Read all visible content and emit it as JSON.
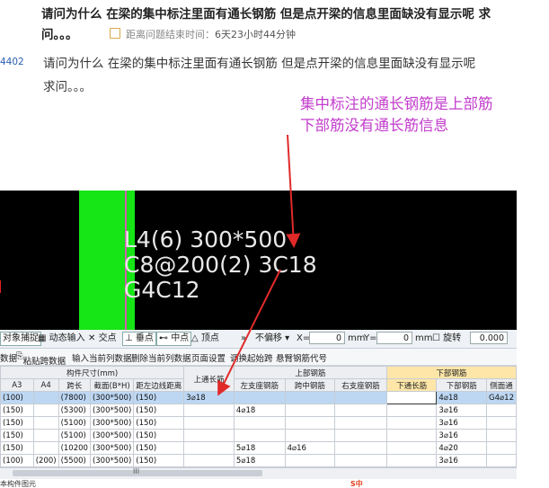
{
  "question": {
    "title_line1": "请问为什么 在梁的集中标注里面有通长钢筋 但是点开梁的信息里面缺没有显示呢 求",
    "title_line2": "问。。。",
    "countdown_label": "距离问题结束时间：",
    "countdown_value": "6天23小时44分钟",
    "id_fragment": "4402",
    "body_line1": "请问为什么 在梁的集中标注里面有通长钢筋 但是点开梁的信息里面缺没有显示呢",
    "body_line2": "求问。。。"
  },
  "annotation": {
    "line1": "集中标注的通长钢筋是上部筋",
    "line2": "下部筋没有通长筋信息",
    "color": "#c23ccc"
  },
  "cad": {
    "line1": "L4(6) 300*500",
    "line2": "C8@200(2) 3C18",
    "line3": "G4C12"
  },
  "toolbar": {
    "snap": "对象捕捉",
    "dynamic_input": "动态输入",
    "intersection": "交点",
    "perpendicular": "垂点",
    "midpoint": "中点",
    "vertex": "顶点",
    "no_offset": "不偏移",
    "x_label": "X=",
    "x_value": "0",
    "mm1": "mm",
    "y_label": "Y=",
    "y_value": "0",
    "mm2": "mm",
    "rotate": "旋转",
    "rotate_value": "0.000"
  },
  "actions": {
    "a0": "数据",
    "a1": "粘贴跨数据",
    "a2": "输入当前列数据",
    "a3": "删除当前列数据",
    "a4": "页面设置",
    "a5": "调换起始跨",
    "a6": "悬臂钢筋代号"
  },
  "grid": {
    "group_size": "构件尺寸(mm)",
    "col_top_through": "上通长筋",
    "group_top": "上部钢筋",
    "group_bottom": "下部钢筋",
    "h_a3": "A3",
    "h_a4": "A4",
    "h_span": "跨长",
    "h_section": "截面(B*H)",
    "h_offset": "距左边线距离",
    "h_left_support": "左支座钢筋",
    "h_mid_span": "跨中钢筋",
    "h_right_support": "右支座钢筋",
    "h_bottom_through": "下通长筋",
    "h_bottom_rebar": "下部钢筋",
    "h_side": "侧面通",
    "rows": [
      {
        "a3": "(100)",
        "a4": "",
        "span": "(7800)",
        "section": "(300*500)",
        "offset": "(150)",
        "top_through": "3⌀18",
        "left": "",
        "mid": "",
        "right": "",
        "bot_through": "",
        "bot": "4⌀18",
        "side": "G4⌀12"
      },
      {
        "a3": "(150)",
        "a4": "",
        "span": "(5300)",
        "section": "(300*500)",
        "offset": "(150)",
        "top_through": "",
        "left": "4⌀18",
        "mid": "",
        "right": "",
        "bot_through": "",
        "bot": "3⌀16",
        "side": ""
      },
      {
        "a3": "(150)",
        "a4": "",
        "span": "(5100)",
        "section": "(300*500)",
        "offset": "(150)",
        "top_through": "",
        "left": "",
        "mid": "",
        "right": "",
        "bot_through": "",
        "bot": "3⌀16",
        "side": ""
      },
      {
        "a3": "(150)",
        "a4": "",
        "span": "(5100)",
        "section": "(300*500)",
        "offset": "(150)",
        "top_through": "",
        "left": "",
        "mid": "",
        "right": "",
        "bot_through": "",
        "bot": "3⌀16",
        "side": ""
      },
      {
        "a3": "(150)",
        "a4": "",
        "span": "(10200",
        "section": "(300*500)",
        "offset": "(150)",
        "top_through": "",
        "left": "5⌀18",
        "mid": "4⌀16",
        "right": "",
        "bot_through": "",
        "bot": "4⌀20",
        "side": ""
      },
      {
        "a3": "(100)",
        "a4": "(200)",
        "span": "(5500)",
        "section": "(300*500)",
        "offset": "(150)",
        "top_through": "",
        "left": "5⌀18",
        "mid": "",
        "right": "",
        "bot_through": "",
        "bot": "3⌀16",
        "side": ""
      }
    ]
  },
  "scroll": {
    "grip": "III"
  },
  "status": {
    "left": "本构件图元",
    "ime": "S中"
  }
}
